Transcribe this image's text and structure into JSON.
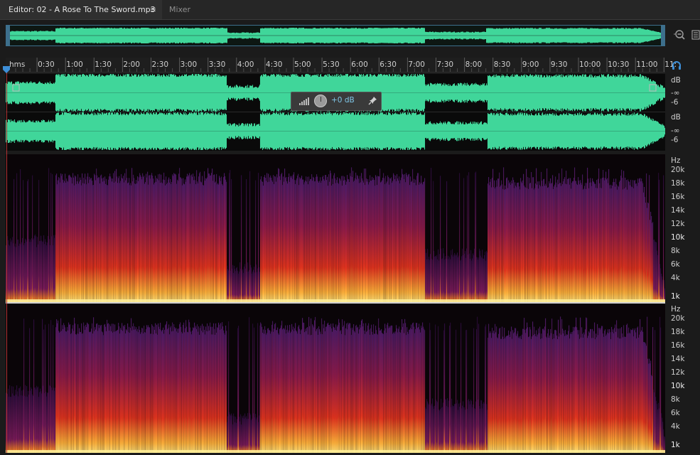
{
  "tabs": {
    "editor_label": "Editor: 02 - A Rose To The Sword.mp3",
    "editor_menu_glyph": "≡",
    "mixer_label": "Mixer"
  },
  "ruler": {
    "labels": [
      "hms",
      "0:30",
      "1:00",
      "1:30",
      "2:00",
      "2:30",
      "3:00",
      "3:30",
      "4:00",
      "4:30",
      "5:00",
      "5:30",
      "6:00",
      "6:30",
      "7:00",
      "7:30",
      "8:00",
      "8:30",
      "9:00",
      "9:30",
      "10:00",
      "10:30",
      "11:00",
      "11:"
    ]
  },
  "waveform_scale": {
    "channel_1": [
      "dB",
      "-∞",
      "-6"
    ],
    "channel_2": [
      "dB",
      "-∞",
      "-6"
    ]
  },
  "hud": {
    "gain_value": "+0 dB"
  },
  "spectral_scale": {
    "channel_1": [
      "Hz",
      "20k",
      "18k",
      "16k",
      "14k",
      "12k",
      "10k",
      "8k",
      "6k",
      "4k",
      "1k"
    ],
    "channel_2": [
      "Hz",
      "20k",
      "18k",
      "16k",
      "14k",
      "12k",
      "10k",
      "8k",
      "6k",
      "4k",
      "1k"
    ]
  },
  "icons": {
    "zoom": "zoom-out-magnifier-icon",
    "panel": "panel-menu-icon",
    "headphones": "headphones-icon",
    "level": "level-meter-icon",
    "pin": "pin-icon",
    "playhead": "playhead-marker-icon"
  },
  "colors": {
    "waveform": "#40d69a",
    "spectral_high": "#ffe27a",
    "spectral_mid": "#e2331e",
    "spectral_low": "#4a1a66",
    "accent": "#3d8fd8"
  }
}
